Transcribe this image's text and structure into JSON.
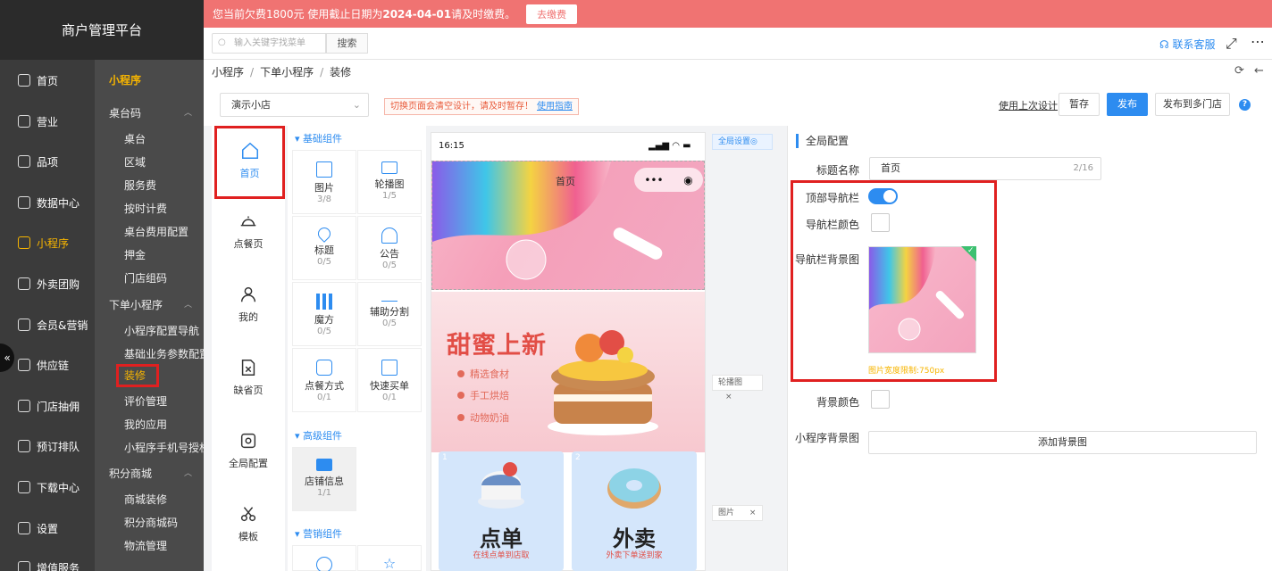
{
  "brand": {
    "title": "商户管理平台"
  },
  "colors": {
    "primary": "#2d8cf0",
    "accent": "#f7b500",
    "notice_bg": "#f07372",
    "highlight": "#e02020"
  },
  "left_nav": [
    {
      "label": "首页",
      "icon": "home-icon"
    },
    {
      "label": "营业",
      "icon": "calendar-icon"
    },
    {
      "label": "品项",
      "icon": "bag-icon"
    },
    {
      "label": "数据中心",
      "icon": "share-icon"
    },
    {
      "label": "小程序",
      "icon": "mini-program-icon"
    },
    {
      "label": "外卖团购",
      "icon": "delivery-icon"
    },
    {
      "label": "会员&营销",
      "icon": "member-icon"
    },
    {
      "label": "供应链",
      "icon": "chain-icon"
    },
    {
      "label": "门店抽佣",
      "icon": "store-icon"
    },
    {
      "label": "预订排队",
      "icon": "queue-icon"
    },
    {
      "label": "下载中心",
      "icon": "download-icon"
    },
    {
      "label": "设置",
      "icon": "gear-icon"
    },
    {
      "label": "增值服务",
      "icon": "value-icon"
    }
  ],
  "sub_nav": {
    "title": "小程序",
    "groups": [
      {
        "label": "桌台码",
        "items": [
          "桌台",
          "区域",
          "服务费",
          "按时计费",
          "桌台费用配置",
          "押金",
          "门店组码"
        ]
      },
      {
        "label": "下单小程序",
        "items": [
          "小程序配置导航",
          "基础业务参数配置",
          "装修",
          "评价管理",
          "我的应用",
          "小程序手机号授权"
        ]
      },
      {
        "label": "积分商城",
        "items": [
          "商城装修",
          "积分商城码",
          "物流管理"
        ]
      }
    ]
  },
  "notice": {
    "prefix": "您当前欠费1800元 使用截止日期为",
    "date": "2024-04-01",
    "suffix": " 请及时缴费。",
    "button": "去缴费"
  },
  "topbar": {
    "search_placeholder": "输入关键字找菜单",
    "search_button": "搜索",
    "service": "联系客服"
  },
  "breadcrumb": [
    "小程序",
    "下单小程序",
    "装修"
  ],
  "toolbar": {
    "store": "演示小店",
    "warning": "切换页面会清空设计，请及时暂存！",
    "guide": "使用指南",
    "use_last": "使用上次设计",
    "save": "暂存",
    "publish": "发布",
    "publish_multi": "发布到多门店",
    "help": "?"
  },
  "page_tabs": [
    "首页",
    "点餐页",
    "我的",
    "缺省页",
    "全局配置",
    "模板"
  ],
  "components": {
    "basic_title": "基础组件",
    "basic": [
      {
        "name": "图片",
        "count": "3/8"
      },
      {
        "name": "轮播图",
        "count": "1/5"
      },
      {
        "name": "标题",
        "count": "0/5"
      },
      {
        "name": "公告",
        "count": "0/5"
      },
      {
        "name": "魔方",
        "count": "0/5"
      },
      {
        "name": "辅助分割",
        "count": "0/5"
      },
      {
        "name": "点餐方式",
        "count": "0/1"
      },
      {
        "name": "快速买单",
        "count": "0/1"
      }
    ],
    "advanced_title": "高级组件",
    "advanced": [
      {
        "name": "店铺信息",
        "count": "1/1"
      }
    ],
    "marketing_title": "营销组件"
  },
  "phone": {
    "time": "16:15",
    "page_title": "首页",
    "capsule": "•••",
    "promo_title": "甜蜜上新",
    "promo_items": [
      "精选食材",
      "手工烘焙",
      "动物奶油"
    ],
    "cards": [
      {
        "num": "1",
        "title": "点单",
        "subtitle": "在线点单到店取"
      },
      {
        "num": "2",
        "title": "外卖",
        "subtitle": "外卖下单送到家"
      }
    ]
  },
  "side_tags": {
    "global": "全局设置◎",
    "carousel": "轮播图",
    "image": "图片",
    "close": "×"
  },
  "config": {
    "header": "全局配置",
    "title_label": "标题名称",
    "title_value": "首页",
    "title_count": "2/16",
    "topnav_label": "顶部导航栏",
    "topnav_on": true,
    "navcolor_label": "导航栏颜色",
    "navbg_label": "导航栏背景图",
    "img_hint": "图片宽度限制:750px",
    "bgcolor_label": "背景颜色",
    "mini_bg_label": "小程序背景图",
    "add_bg": "添加背景图"
  }
}
